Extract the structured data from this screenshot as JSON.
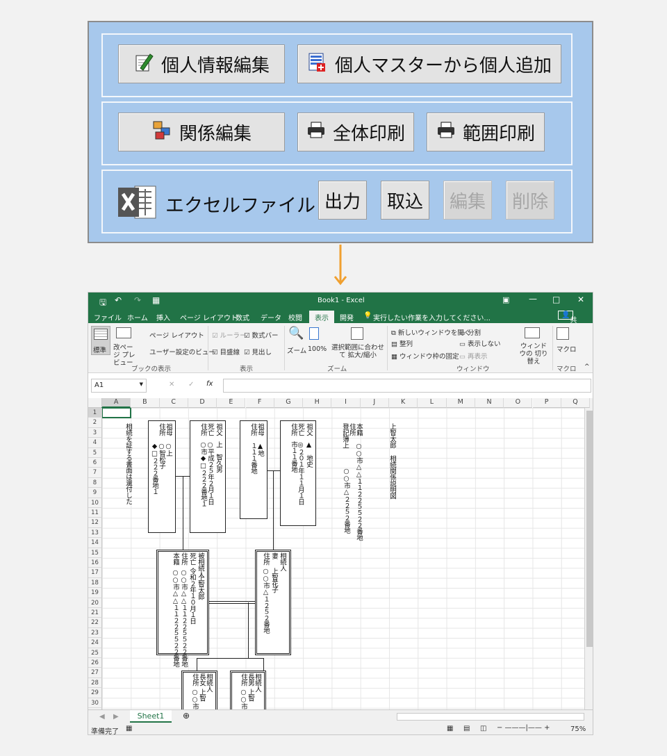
{
  "panel": {
    "personal_edit": "個人情報編集",
    "add_from_master": "個人マスターから個人追加",
    "relation_edit": "関係編集",
    "print_all": "全体印刷",
    "print_range": "範囲印刷",
    "excel_file": "エクセルファイル",
    "output": "出力",
    "import": "取込",
    "edit": "編集",
    "delete": "削除"
  },
  "excel": {
    "title": "Book1 - Excel",
    "tabs": [
      "ファイル",
      "ホーム",
      "挿入",
      "ページ レイアウト",
      "数式",
      "データ",
      "校閲",
      "表示",
      "開発"
    ],
    "active_tab": "表示",
    "tell_me": "実行したい作業を入力してください...",
    "share": "共有",
    "ribbon": {
      "normal": "標準",
      "page_break": "改ページ プレビュー",
      "page_layout": "ページ レイアウト",
      "user_view": "ユーザー設定のビュー",
      "ruler": "ルーラー",
      "formula_bar": "数式バー",
      "gridlines": "目盛線",
      "headings": "見出し",
      "zoom": "ズーム",
      "zoom100": "100%",
      "zoom_sel": "選択範囲に合わせて 拡大/縮小",
      "new_window": "新しいウィンドウを開く",
      "arrange": "整列",
      "freeze": "ウィンドウ枠の固定",
      "split": "分割",
      "hide": "表示しない",
      "unhide": "再表示",
      "switch": "ウィンドウの 切り替え",
      "macro": "マクロ",
      "grp_book": "ブックの表示",
      "grp_show": "表示",
      "grp_zoom": "ズーム",
      "grp_window": "ウィンドウ",
      "grp_macro": "マクロ"
    },
    "namebox": "A1",
    "fx": "fx",
    "columns": [
      "A",
      "B",
      "C",
      "D",
      "E",
      "F",
      "G",
      "H",
      "I",
      "J",
      "K",
      "L",
      "M",
      "N",
      "O",
      "P",
      "Q"
    ],
    "rows": [
      "1",
      "2",
      "3",
      "4",
      "5",
      "6",
      "7",
      "8",
      "9",
      "10",
      "11",
      "12",
      "13",
      "14",
      "15",
      "16",
      "17",
      "18",
      "19",
      "20",
      "21",
      "22",
      "23",
      "24",
      "25",
      "26",
      "27",
      "28",
      "29",
      "30",
      "31"
    ],
    "sheet": "Sheet1",
    "status": "準備完了",
    "zoom_level": "75%",
    "cells": {
      "note": "相続を証する書面は還付した",
      "gm1_a": "祖母",
      "gm1_b": "住所",
      "gm1_c": "○上",
      "gm1_d": "○智松子",
      "gm1_e": "市",
      "gm1_f": "◆□２２２番地１",
      "gf1_a": "祖父",
      "gf1_b": "死亡",
      "gf1_c": "住所",
      "gf1_d": "上　智久男",
      "gf1_e": "○平成２５年２月１日",
      "gf1_f": "○市◆□２２２番地１",
      "gm2_a": "祖母",
      "gm2_b": "住所",
      "gm2_c": "▲地",
      "gm2_d": "△市",
      "gm2_e": "◎時子",
      "gm2_f": "１１１番地",
      "gf2_a": "祖父",
      "gf2_b": "死亡",
      "gf2_c": "住所",
      "gf2_d": "▲　地史",
      "gf2_e": "△平成博",
      "gf2_f": "◎２０１年１１月１日",
      "gf2_g": "市１１番地",
      "reg_a": "本籍",
      "reg_b": "住所",
      "reg_c": "登記簿上",
      "reg_d": "○○市△△１１２２５５２２番地",
      "reg_e": "○○市△２２５２番地",
      "title_a": "上智太郎",
      "title_b": "相続関係説明図",
      "dec_a": "被相続人",
      "dec_b": "死亡",
      "dec_c": "上智太郎",
      "dec_d": "令和２年１０月１日",
      "dec_e": "住所",
      "dec_f": "○○市△△１１２２５５２２番地",
      "dec_g": "本籍",
      "dec_h": "○○市△△１１２２５５２２番地",
      "wife_a": "相続人",
      "wife_b": "妻",
      "wife_c": "上智花子",
      "wife_d": "住所",
      "wife_e": "○○市△１２５２番地",
      "c1_a": "相続人",
      "c1_b": "長女",
      "c1_c": "上智",
      "c1_d": "住所",
      "c1_e": "○○市恵",
      "c2_a": "相続人",
      "c2_b": "長男",
      "c2_c": "上智",
      "c2_d": "住所",
      "c2_e": "○○市次"
    }
  }
}
